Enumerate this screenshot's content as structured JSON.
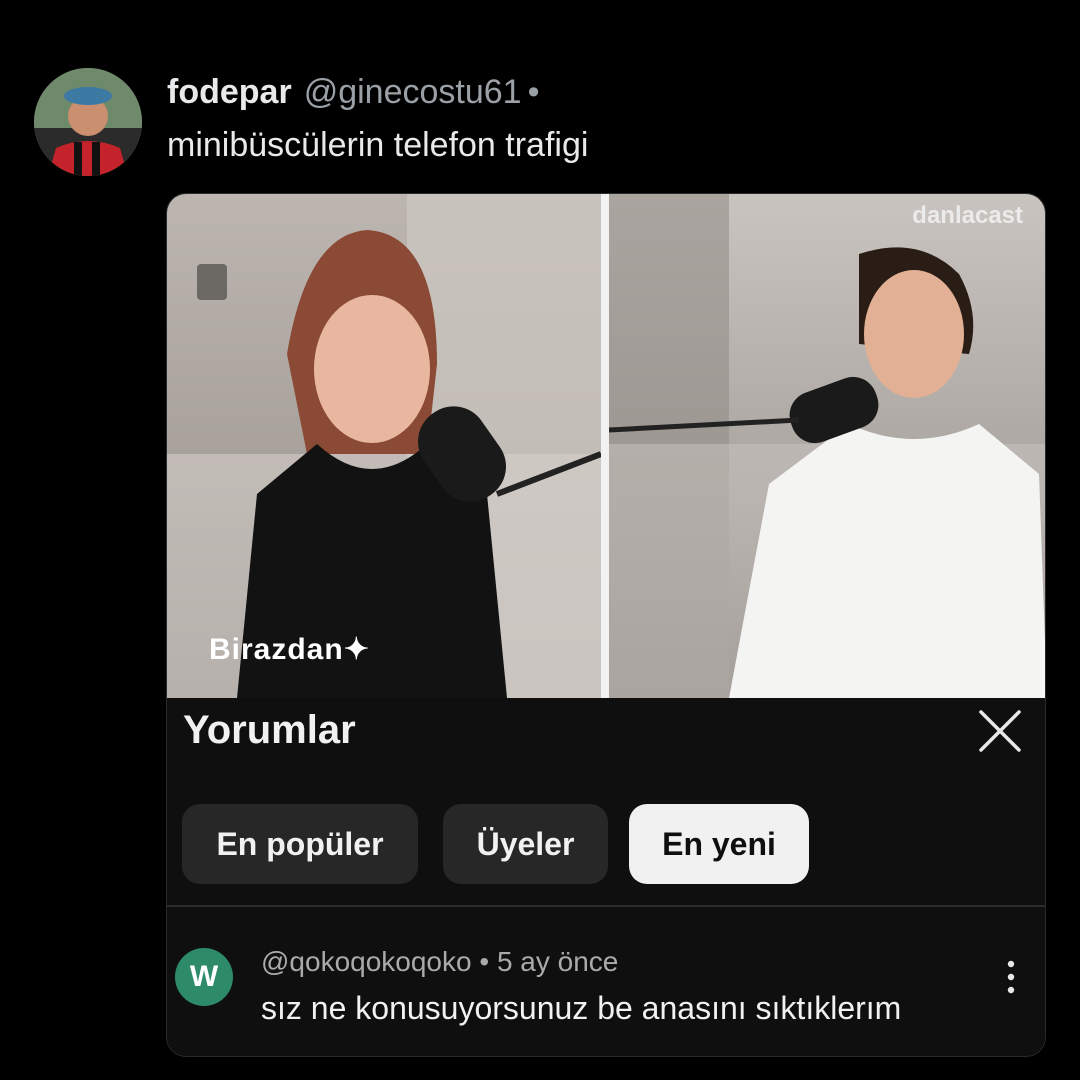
{
  "tweet": {
    "display_name": "fodepar",
    "handle": "@ginecostu61",
    "separator": "•",
    "text": "minibüscülerin telefon trafigi"
  },
  "media": {
    "watermark": "danlacast",
    "overlay_text": "Birazdan✦",
    "comments_title": "Yorumlar",
    "filters": [
      {
        "label": "En popüler",
        "selected": false
      },
      {
        "label": "Üyeler",
        "selected": false
      },
      {
        "label": "En yeni",
        "selected": true
      }
    ],
    "comment": {
      "avatar_letter": "W",
      "author": "@qokoqokoqoko",
      "dot": "•",
      "time": "5 ay önce",
      "text": "sız ne konusuyorsunuz be anasını sıktıklerım"
    }
  },
  "colors": {
    "background": "#000000",
    "comment_avatar": "#2e8b6a",
    "chip_selected": "#f1f1f1",
    "chip_default": "#272727"
  }
}
